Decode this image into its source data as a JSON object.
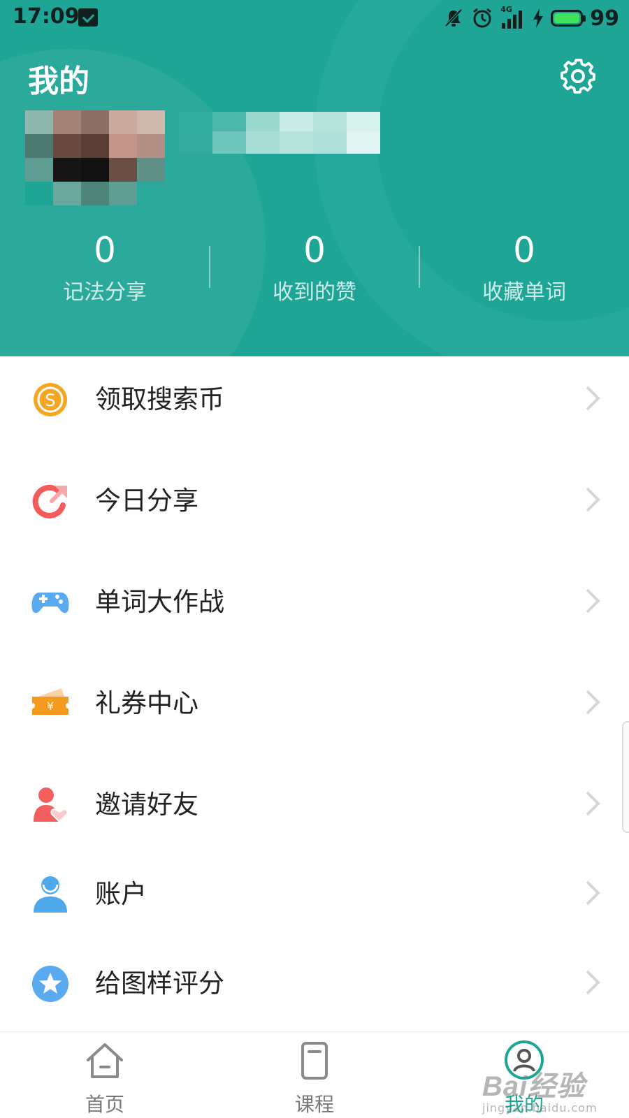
{
  "status_bar": {
    "time": "17:09",
    "network": "4G",
    "battery": "99"
  },
  "header": {
    "title": "我的",
    "settings_icon": "gear-icon"
  },
  "stats": [
    {
      "value": "0",
      "label": "记法分享"
    },
    {
      "value": "0",
      "label": "收到的赞"
    },
    {
      "value": "0",
      "label": "收藏单词"
    }
  ],
  "menu": [
    {
      "label": "领取搜索币",
      "icon": "coin-icon",
      "icon_color": "#f5a623"
    },
    {
      "label": "今日分享",
      "icon": "share-icon",
      "icon_color": "#f45c5c"
    },
    {
      "label": "单词大作战",
      "icon": "gamepad-icon",
      "icon_color": "#5aaaf0"
    },
    {
      "label": "礼券中心",
      "icon": "coupon-icon",
      "icon_color": "#f39a1f"
    },
    {
      "label": "邀请好友",
      "icon": "invite-friend-icon",
      "icon_color": "#f25f5f"
    },
    {
      "label": "账户",
      "icon": "user-icon",
      "icon_color": "#4fa8ec"
    },
    {
      "label": "给图样评分",
      "icon": "star-icon",
      "icon_color": "#5aaaf0"
    }
  ],
  "bottom_nav": [
    {
      "label": "首页",
      "icon": "home-icon",
      "active": false
    },
    {
      "label": "课程",
      "icon": "book-icon",
      "active": false
    },
    {
      "label": "我的",
      "icon": "profile-icon",
      "active": true
    }
  ],
  "watermark": {
    "brand": "Bai经验",
    "url": "jingyan.baidu.com"
  },
  "colors": {
    "accent": "#1ea596",
    "text": "#222222",
    "muted": "#777777"
  }
}
